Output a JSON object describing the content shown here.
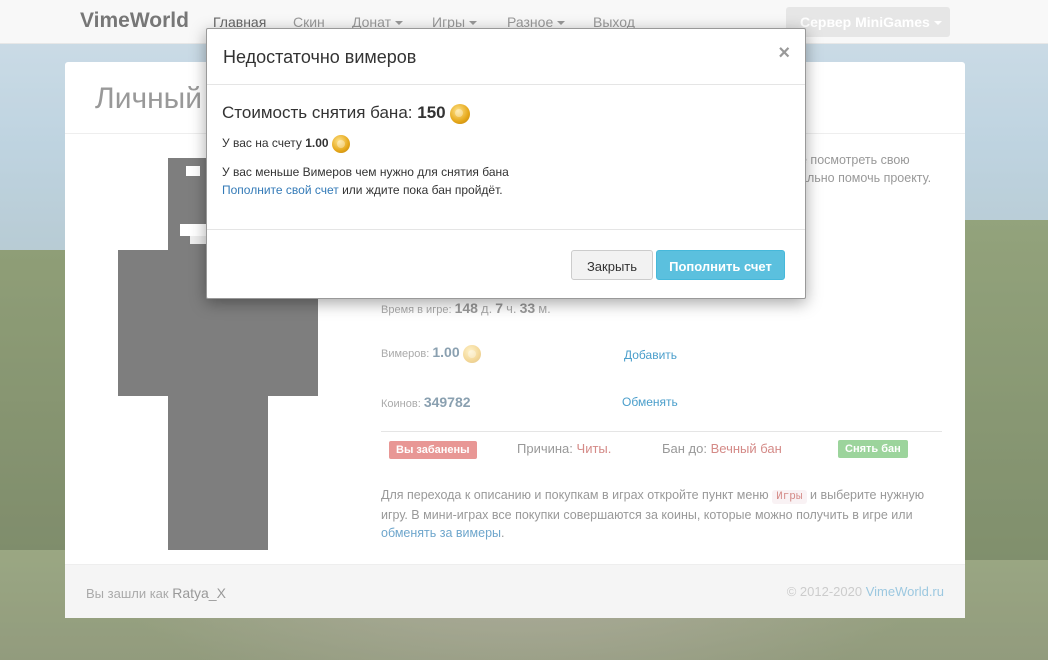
{
  "navbar": {
    "brand": "VimeWorld",
    "items": [
      {
        "label": "Главная",
        "dropdown": false
      },
      {
        "label": "Скин",
        "dropdown": false
      },
      {
        "label": "Донат",
        "dropdown": true
      },
      {
        "label": "Игры",
        "dropdown": true
      },
      {
        "label": "Разное",
        "dropdown": true
      },
      {
        "label": "Выход",
        "dropdown": false
      }
    ],
    "server_button": "Сервер MiniGames"
  },
  "page": {
    "title": "Личный",
    "intro_line1": "е посмотреть свою",
    "intro_line2": "ально помочь проекту."
  },
  "stats": {
    "playtime_label": "Время в игре:",
    "days": "148",
    "days_unit": "д.",
    "hours": "7",
    "hours_unit": "ч.",
    "minutes": "33",
    "minutes_unit": "м.",
    "vimers_label": "Вимеров:",
    "vimers_value": "1.00",
    "vimers_action": "Добавить",
    "coins_label": "Коинов:",
    "coins_value": "349782",
    "coins_action": "Обменять"
  },
  "ban": {
    "status": "Вы забанены",
    "reason_label": "Причина:",
    "reason_value": "Читы.",
    "until_label": "Бан до:",
    "until_value": "Вечный бан",
    "unban_button": "Снять бан"
  },
  "info": {
    "part1": "Для перехода к описанию и покупкам в играх откройте пункт меню",
    "code": "Игры",
    "part2": "и выберите нужную игру. В мини-играх все покупки совершаются за коины, которые можно получить в игре или",
    "link": "обменять за вимеры",
    "end": "."
  },
  "footer": {
    "logged_as": "Вы зашли как",
    "username": "Ratya_X",
    "copyright": "© 2012-2020",
    "site": "VimeWorld.ru"
  },
  "modal": {
    "title": "Недостаточно вимеров",
    "close_symbol": "×",
    "cost_label": "Стоимость снятия бана:",
    "cost_value": "150",
    "balance_label": "У вас на счету",
    "balance_value": "1.00",
    "message_line1": "У вас меньше Вимеров чем нужно для снятия бана",
    "message_link": "Пополните свой счет",
    "message_rest": "или ждите пока бан пройдёт.",
    "close_button": "Закрыть",
    "topup_button": "Пополнить счет"
  },
  "icons": {
    "coin": "vimer-coin-icon",
    "caret": "caret-down-icon"
  },
  "colors": {
    "link": "#337ab7",
    "danger": "#d9534f",
    "success": "#5cb85c",
    "info_button": "#5bc0de"
  }
}
